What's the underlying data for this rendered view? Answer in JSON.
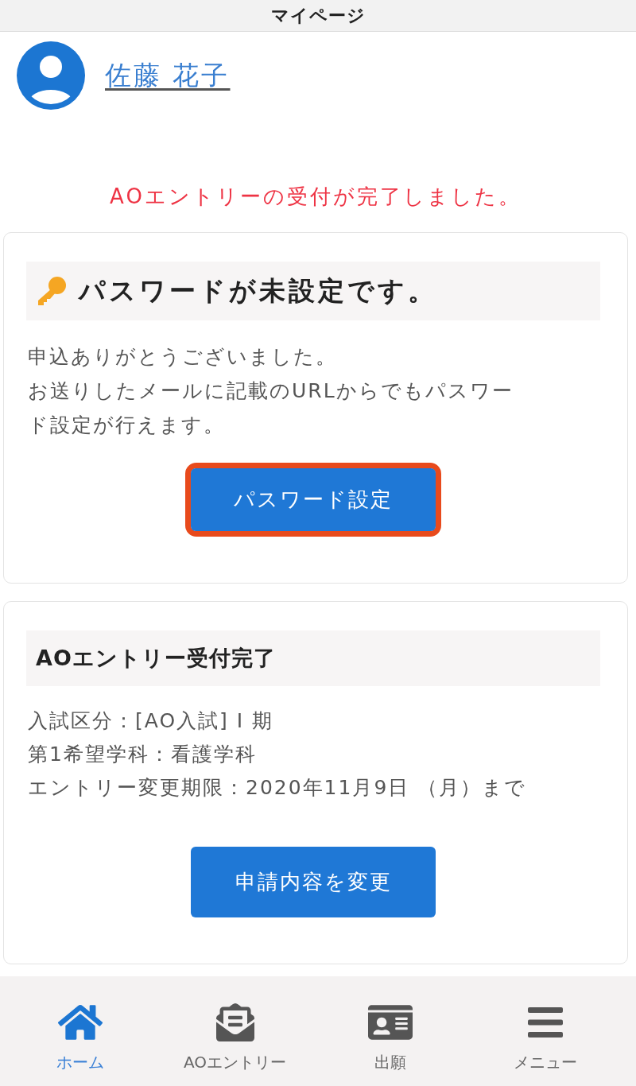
{
  "header": {
    "title": "マイページ"
  },
  "profile": {
    "name": "佐藤 花子"
  },
  "notice": "AOエントリーの受付が完了しました。",
  "cards": [
    {
      "kind": "password",
      "title": "パスワードが未設定です。",
      "lines": [
        "申込ありがとうございました。",
        "お送りしたメールに記載のURLからでもパスワード設定が行えます。"
      ],
      "button": {
        "label": "パスワード設定",
        "highlighted": true
      }
    },
    {
      "kind": "entry",
      "title": "AOエントリー受付完了",
      "lines": [
        "入試区分：[AO入試] I 期",
        "第1希望学科：看護学科",
        "エントリー変更期限：2020年11月9日 （月）まで"
      ],
      "button": {
        "label": "申請内容を変更",
        "highlighted": false
      }
    }
  ],
  "bottom_nav": [
    {
      "kind": "home",
      "label": "ホーム",
      "selected": true
    },
    {
      "kind": "entry",
      "label": "AOエントリー",
      "selected": false
    },
    {
      "kind": "application",
      "label": "出願",
      "selected": false
    },
    {
      "kind": "menu",
      "label": "メニュー",
      "selected": false
    }
  ]
}
